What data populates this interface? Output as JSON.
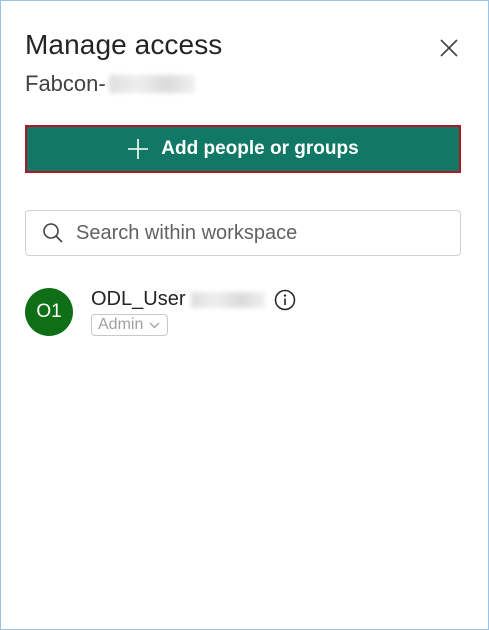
{
  "panel": {
    "title": "Manage access",
    "workspace_prefix": "Fabcon-",
    "add_button_label": "Add people or groups",
    "search": {
      "placeholder": "Search within workspace"
    },
    "members": [
      {
        "initials": "O1",
        "name": "ODL_User",
        "role": "Admin"
      }
    ]
  },
  "colors": {
    "add_button_bg": "#117865",
    "add_button_border": "#b0162a",
    "avatar_bg": "#0e6f17",
    "panel_border": "#9bc3e6"
  },
  "icons": [
    "close-icon",
    "plus-icon",
    "search-icon",
    "info-icon",
    "chevron-down-icon"
  ]
}
